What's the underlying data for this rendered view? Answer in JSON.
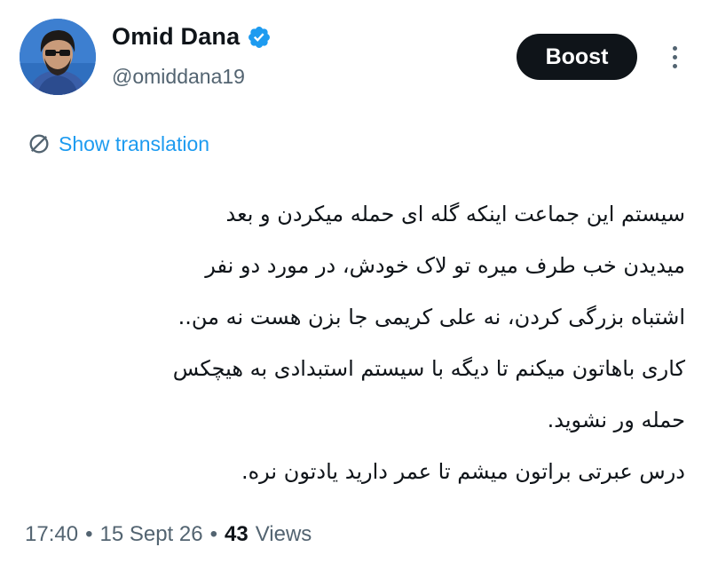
{
  "author": {
    "name": "Omid Dana",
    "handle": "@omiddana19"
  },
  "header": {
    "boost_label": "Boost"
  },
  "translation": {
    "label": "Show translation"
  },
  "tweet": {
    "lines": [
      "سیستم این جماعت اینکه گله ای حمله میکردن و بعد",
      "میدیدن خب طرف میره تو لاک خودش، در مورد دو نفر",
      "اشتباه بزرگی کردن، نه علی کریمی جا بزن هست نه من..",
      "کاری باهاتون میکنم تا دیگه با سیستم استبدادی به هیچکس",
      "حمله ور نشوید.",
      "درس عبرتی براتون میشم تا عمر دارید یادتون نره."
    ]
  },
  "meta": {
    "time": "17:40",
    "date": "15 Sept 26",
    "separator": "•",
    "views_count": "43",
    "views_label": "Views"
  },
  "colors": {
    "accent": "#1d9bf0",
    "text": "#0f1419",
    "secondary": "#536471",
    "button_bg": "#0f1419"
  },
  "icons": [
    "verified-badge-icon",
    "translate-icon",
    "more-options-icon"
  ]
}
